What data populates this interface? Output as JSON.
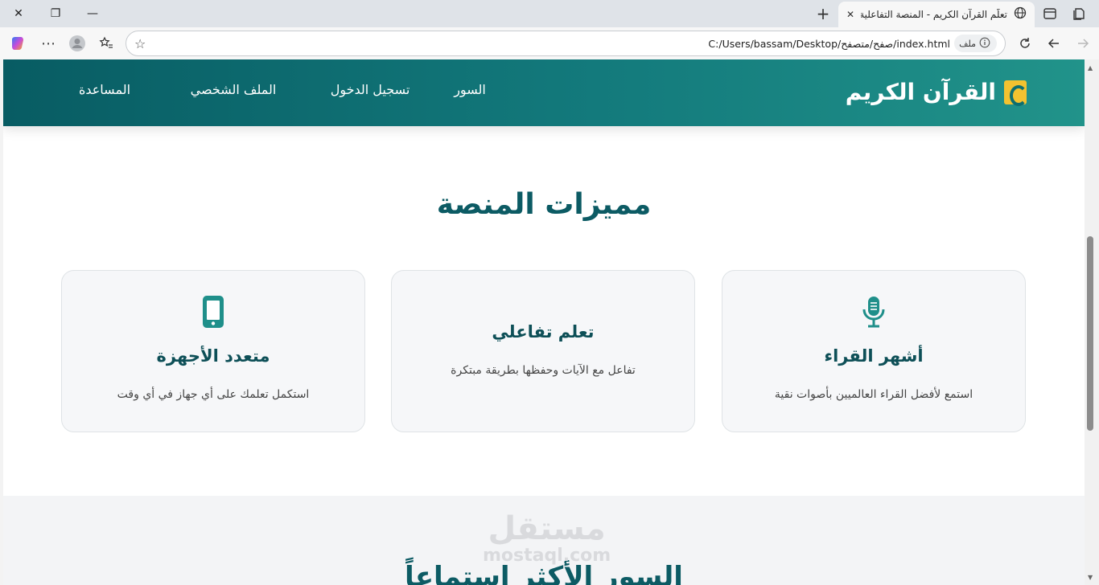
{
  "browser": {
    "tab_title": "تعلّم القرآن الكريم - المنصة التفاعلية",
    "url": "C:/Users/bassam/Desktop/صفح/متصفح/index.html",
    "url_chip": "ملف"
  },
  "navbar": {
    "brand": "القرآن الكريم",
    "links": [
      "السور",
      "تسجيل الدخول",
      "الملف الشخصي",
      "المساعدة"
    ]
  },
  "features": {
    "title": "مميزات المنصة",
    "cards": [
      {
        "icon": "microphone-icon",
        "title": "أشهر القراء",
        "desc": "استمع لأفضل القراء العالميين بأصوات نقية"
      },
      {
        "icon": "",
        "title": "تعلم تفاعلي",
        "desc": "تفاعل مع الآيات وحفظها بطريقة مبتكرة"
      },
      {
        "icon": "mobile-icon",
        "title": "متعدد الأجهزة",
        "desc": "استكمل تعلمك على أي جهاز في أي وقت"
      }
    ]
  },
  "watermark": {
    "ar": "مستقل",
    "en": "mostaql.com"
  },
  "next_section": {
    "title": "السور الأكثر استماعاً"
  },
  "colors": {
    "primary": "#0c5b64",
    "accent": "#f2c230",
    "nav_start": "#085c63",
    "nav_end": "#21938a"
  }
}
